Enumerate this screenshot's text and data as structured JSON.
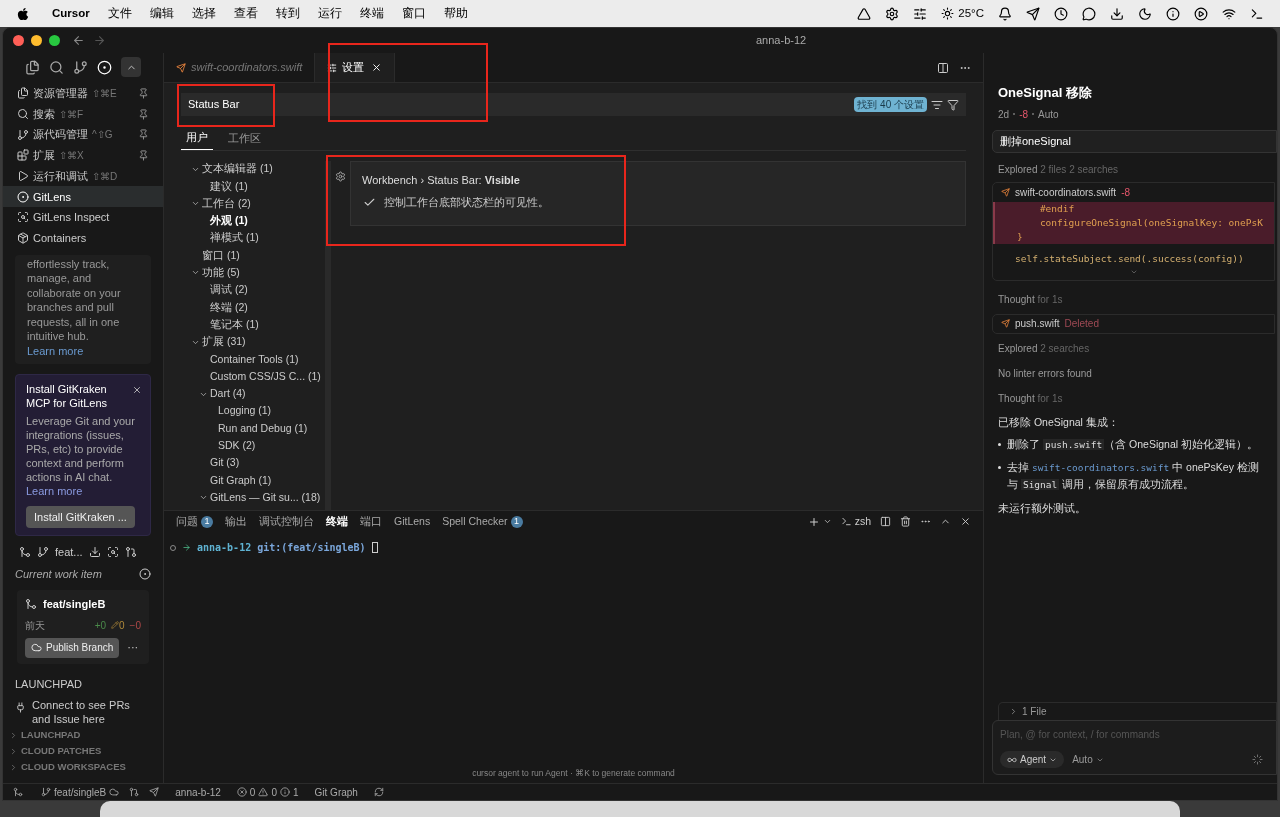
{
  "menubar": {
    "app": "Cursor",
    "menus": [
      "文件",
      "编辑",
      "选择",
      "查看",
      "转到",
      "运行",
      "终端",
      "窗口",
      "帮助"
    ],
    "weather": "25°C"
  },
  "window": {
    "title": "anna-b-12"
  },
  "sidebar": {
    "views": [
      {
        "label": "资源管理器",
        "shortcut": "⇧⌘E",
        "pinned": true,
        "selected": false
      },
      {
        "label": "搜索",
        "shortcut": "⇧⌘F",
        "pinned": true,
        "selected": false
      },
      {
        "label": "源代码管理",
        "shortcut": "^⇧G",
        "pinned": true,
        "selected": false
      },
      {
        "label": "扩展",
        "shortcut": "⇧⌘X",
        "pinned": true,
        "selected": false
      },
      {
        "label": "运行和调试",
        "shortcut": "⇧⌘D",
        "pinned": false,
        "selected": false
      },
      {
        "label": "GitLens",
        "pinned": false,
        "selected": true
      },
      {
        "label": "GitLens Inspect",
        "pinned": false,
        "selected": false
      },
      {
        "label": "Containers",
        "pinned": false,
        "selected": false
      }
    ],
    "promo_text": "effortlessly track, manage, and collaborate on your branches and pull requests, all in one intuitive hub.",
    "promo_link": "Learn more",
    "mcp_card": {
      "title": "Install GitKraken MCP for GitLens",
      "body": "Leverage Git and your integrations (issues, PRs, etc) to provide context and perform actions in AI chat.",
      "link": "Learn more",
      "button": "Install GitKraken ..."
    },
    "branch_label": "feat...",
    "work_item": "Current work item",
    "branch": {
      "name": "feat/singleB",
      "time": "前天",
      "added": "+0",
      "changed": "0",
      "removed": "−0",
      "publish": "Publish Branch",
      "more": "···"
    },
    "launchpad": {
      "heading": "LAUNCHPAD",
      "message": "Connect to see PRs and Issue here"
    },
    "sections": [
      {
        "label": "LAUNCHPAD",
        "expanded": false
      },
      {
        "label": "CLOUD PATCHES",
        "expanded": false
      },
      {
        "label": "CLOUD WORKSPACES",
        "expanded": false
      }
    ]
  },
  "editor": {
    "tabs": [
      {
        "label": "swift-coordinators.swift",
        "kind": "file",
        "selected": false
      },
      {
        "label": "设置",
        "kind": "settings",
        "selected": true
      }
    ],
    "settings": {
      "search": "Status Bar",
      "result_count": "找到 40 个设置",
      "scopes": [
        {
          "label": "用户",
          "selected": true
        },
        {
          "label": "工作区",
          "selected": false
        }
      ],
      "tree": [
        {
          "label": "文本编辑器 (1)",
          "expanded": true,
          "selected": false,
          "children": [
            {
              "label": "建议 (1)",
              "selected": false
            }
          ]
        },
        {
          "label": "工作台 (2)",
          "expanded": true,
          "selected": false,
          "children": [
            {
              "label": "外观 (1)",
              "selected": true
            },
            {
              "label": "禅模式 (1)",
              "selected": false
            }
          ]
        },
        {
          "label": "窗口 (1)",
          "selected": false
        },
        {
          "label": "功能 (5)",
          "expanded": true,
          "selected": false,
          "children": [
            {
              "label": "调试 (2)",
              "selected": false
            },
            {
              "label": "终端 (2)",
              "selected": false
            },
            {
              "label": "笔记本 (1)",
              "selected": false
            }
          ]
        },
        {
          "label": "扩展 (31)",
          "expanded": true,
          "selected": false,
          "children": [
            {
              "label": "Container Tools (1)",
              "selected": false
            },
            {
              "label": "Custom CSS/JS C... (1)",
              "selected": false
            },
            {
              "label": "Dart (4)",
              "expanded": true,
              "selected": false,
              "children": [
                {
                  "label": "Logging (1)",
                  "selected": false
                },
                {
                  "label": "Run and Debug (1)",
                  "selected": false
                },
                {
                  "label": "SDK (2)",
                  "selected": false
                }
              ]
            },
            {
              "label": "Git (3)",
              "selected": false
            },
            {
              "label": "Git Graph (1)",
              "selected": false
            },
            {
              "label": "GitLens — Git su... (18)",
              "expanded": true,
              "selected": false
            }
          ]
        }
      ],
      "item": {
        "title": "Workbench › Status Bar: **Visible**",
        "description": "控制工作台底部状态栏的可见性。",
        "checked": true
      }
    }
  },
  "panel": {
    "tabs": [
      {
        "label": "问题",
        "badge": "1",
        "selected": false
      },
      {
        "label": "输出",
        "selected": false
      },
      {
        "label": "调试控制台",
        "selected": false
      },
      {
        "label": "终端",
        "selected": true
      },
      {
        "label": "端口",
        "selected": false
      },
      {
        "label": "GitLens",
        "selected": false
      },
      {
        "label": "Spell Checker",
        "badge": "1",
        "selected": false
      }
    ],
    "shell": "zsh",
    "prompt": {
      "dir": "anna-b-12",
      "git": "git:(feat/singleB)"
    },
    "hint": "cursor agent to run Agent · ⌘K to generate command"
  },
  "status_bar": {
    "branch": "feat/singleB",
    "workspace": "anna-b-12",
    "errors": "0",
    "warnings": "0",
    "infos": "1",
    "git_graph": "Git Graph"
  },
  "chat": {
    "title": "OneSignal 移除",
    "meta": {
      "age": "2d",
      "delta": "-8",
      "model": "Auto"
    },
    "query": "删掉oneSignal",
    "steps": [
      {
        "kind": "note",
        "label": "Explored",
        "detail": "2 files 2 searches"
      },
      {
        "kind": "diff",
        "file": "swift-coordinators.swift",
        "delta": "-8",
        "lines": [
          {
            "kind": "removed",
            "text": "    #endif"
          },
          {
            "kind": "removed",
            "text": "    configureOneSignal(oneSignalKey: onePsK"
          },
          {
            "kind": "removed",
            "text": "}"
          },
          {
            "kind": "context",
            "text": "self.stateSubject.send(.success(config))"
          }
        ]
      },
      {
        "kind": "note",
        "label": "Thought",
        "detail": "for 1s"
      },
      {
        "kind": "file",
        "file": "push.swift",
        "status": "Deleted"
      },
      {
        "kind": "note",
        "label": "Explored",
        "detail": "2 searches"
      },
      {
        "kind": "note",
        "label": "No linter errors found"
      },
      {
        "kind": "note",
        "label": "Thought",
        "detail": "for 1s"
      }
    ],
    "summary": {
      "heading": "已移除 OneSignal 集成：",
      "bullets": [
        [
          {
            "kind": "text",
            "text": "删除了 "
          },
          {
            "kind": "code",
            "text": "push.swift"
          },
          {
            "kind": "text",
            "text": "（含 OneSignal 初始化逻辑）。"
          }
        ],
        [
          {
            "kind": "text",
            "text": "去掉 "
          },
          {
            "kind": "path",
            "text": "swift-coordinators.swift"
          },
          {
            "kind": "text",
            "text": " 中 onePsKey 检测与 "
          },
          {
            "kind": "code",
            "text": "Signal"
          },
          {
            "kind": "text",
            "text": " 调用，保留原有成功流程。"
          }
        ]
      ],
      "footer": "未运行额外测试。"
    },
    "files": "1 File",
    "composer": {
      "placeholder": "Plan, @ for context, / for commands",
      "mode": "Agent",
      "model": "Auto"
    }
  }
}
